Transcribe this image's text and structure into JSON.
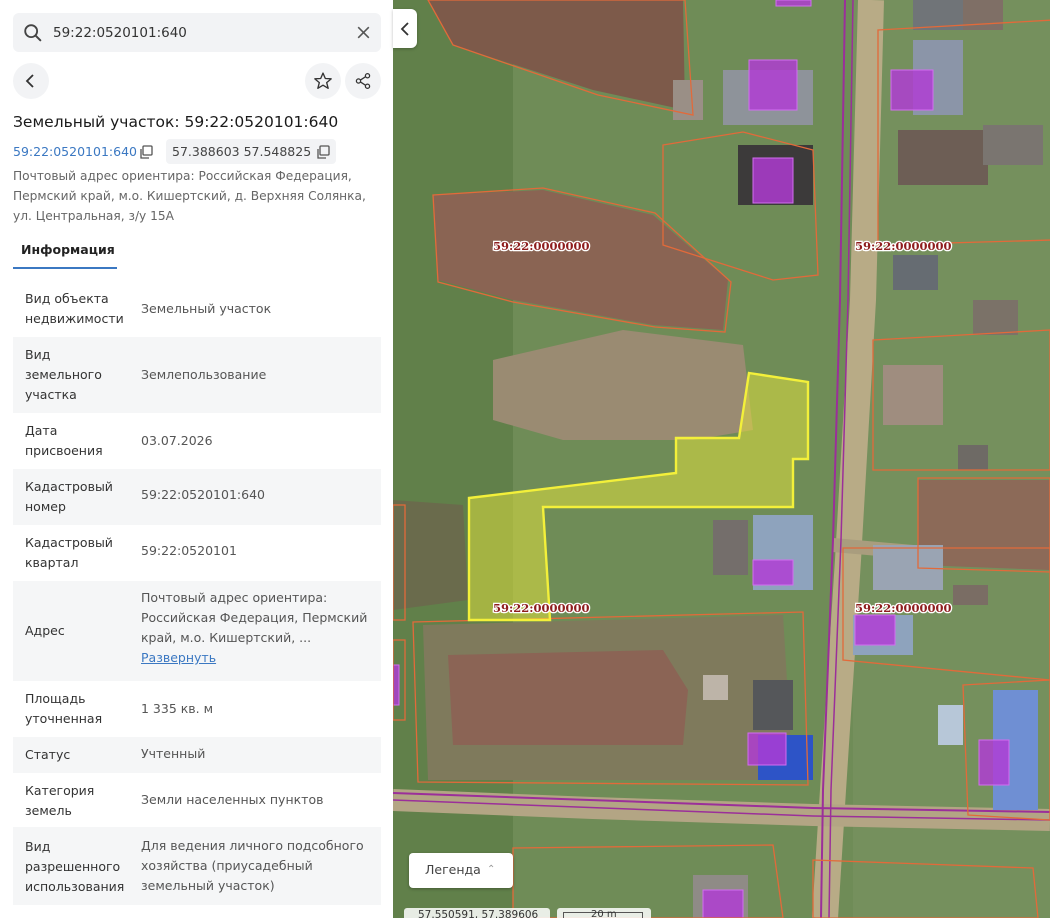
{
  "search": {
    "value": "59:22:0520101:640",
    "placeholder": ""
  },
  "header": {
    "title": "Земельный участок: 59:22:0520101:640",
    "cadastral_link": "59:22:0520101:640",
    "coordinates": "57.388603 57.548825",
    "address_lines": [
      "Почтовый адрес ориентира: Российская Федерация,",
      "Пермский край, м.о. Кишертский, д. Верхняя Солянка,",
      "ул. Центральная, з/у 15А"
    ]
  },
  "tabs": {
    "info": "Информация"
  },
  "rows": [
    {
      "label_lines": [
        "Вид объекта",
        "недвижимости"
      ],
      "value_lines": [
        "Земельный участок"
      ]
    },
    {
      "label_lines": [
        "Вид",
        "земельного",
        "участка"
      ],
      "value_lines": [
        "Землепользование"
      ]
    },
    {
      "label_lines": [
        "Дата",
        "присвоения"
      ],
      "value_lines": [
        "03.07.2026"
      ]
    },
    {
      "label_lines": [
        "Кадастровый",
        "номер"
      ],
      "value_lines": [
        "59:22:0520101:640"
      ]
    },
    {
      "label_lines": [
        "Кадастровый",
        "квартал"
      ],
      "value_lines": [
        "59:22:0520101"
      ]
    },
    {
      "label_lines": [
        "Адрес"
      ],
      "value_lines": [
        "Почтовый адрес ориентира:",
        "Российская Федерация, Пермский",
        "край, м.о. Кишертский, ..."
      ],
      "link": "Развернуть"
    },
    {
      "label_lines": [
        "Площадь",
        "уточненная"
      ],
      "value_lines": [
        "1 335 кв. м"
      ]
    },
    {
      "label_lines": [
        "Статус"
      ],
      "value_lines": [
        "Учтенный"
      ]
    },
    {
      "label_lines": [
        "Категория",
        "земель"
      ],
      "value_lines": [
        "Земли населенных пунктов"
      ]
    },
    {
      "label_lines": [
        "Вид",
        "разрешенного",
        "использования"
      ],
      "value_lines": [
        "Для ведения личного подсобного",
        "хозяйства (приусадебный",
        "земельный участок)"
      ]
    }
  ],
  "map": {
    "parcel_labels": [
      "59:22:0000000",
      "59:22:0000000",
      "59:22:0000000",
      "59:22:0000000"
    ],
    "legend_label": "Легенда",
    "coord_readout": "57.550591, 57.389606",
    "scale_label": "20 m",
    "colors": {
      "selected_fill": "#e8e63c",
      "selected_stroke": "#f3f03a",
      "boundary": "#e26a3a",
      "building": "#b13ad6",
      "road_line": "#9b2f9a"
    }
  }
}
